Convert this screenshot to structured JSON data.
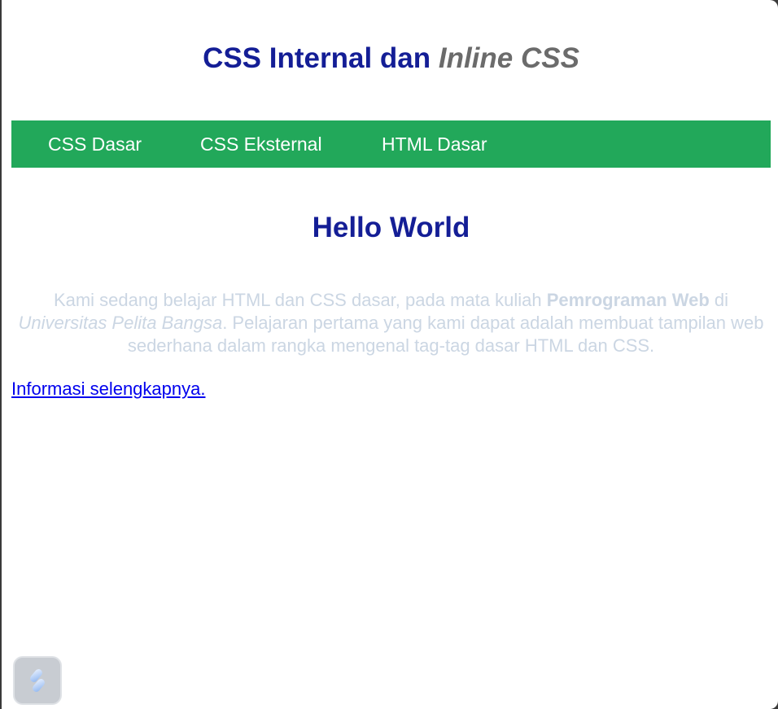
{
  "header": {
    "title_main": "CSS Internal dan ",
    "title_italic": "Inline CSS"
  },
  "nav": {
    "items": [
      {
        "label": "CSS Dasar"
      },
      {
        "label": "CSS Eksternal"
      },
      {
        "label": "HTML Dasar"
      }
    ],
    "background": "#22a85a"
  },
  "main": {
    "heading": "Hello World",
    "paragraph": {
      "part1": "Kami sedang belajar HTML dan CSS dasar, pada mata kuliah ",
      "bold": "Pemrograman Web",
      "part2": " di ",
      "italic": "Universitas Pelita Bangsa",
      "part3": ". Pelajaran pertama yang kami dapat adalah membuat tampilan web sederhana dalam rangka mengenal tag-tag dasar HTML dan CSS."
    },
    "link_text": "Informasi selengkapnya."
  },
  "colors": {
    "heading": "#141e96",
    "italic_title": "#6b6b6b",
    "paragraph": "#cbd6e3",
    "link": "#0000ee"
  },
  "floating_button": {
    "icon": "extension-logo-icon"
  }
}
